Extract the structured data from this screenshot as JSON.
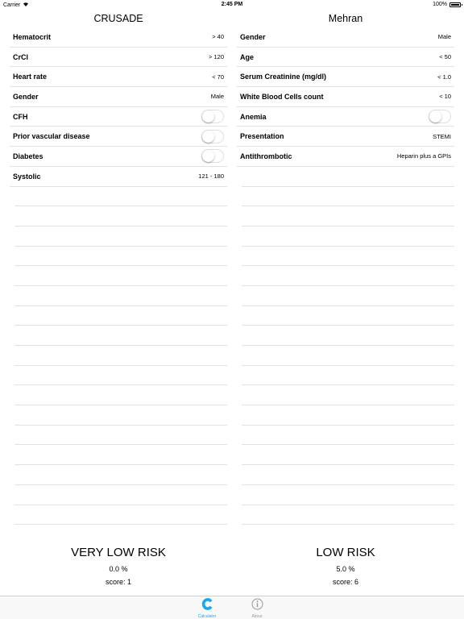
{
  "status_bar": {
    "carrier": "Carrier",
    "time": "2:45 PM",
    "battery": "100%"
  },
  "crusade": {
    "title": "CRUSADE",
    "rows": [
      {
        "label": "Hematocrit",
        "value": "> 40"
      },
      {
        "label": "CrCl",
        "value": "> 120"
      },
      {
        "label": "Heart rate",
        "value": "< 70"
      },
      {
        "label": "Gender",
        "value": "Male"
      },
      {
        "label": "CFH",
        "toggle": false
      },
      {
        "label": "Prior vascular disease",
        "toggle": false
      },
      {
        "label": "Diabetes",
        "toggle": false
      },
      {
        "label": "Systolic",
        "value": "121 - 180"
      }
    ],
    "result": {
      "risk_level": "VERY LOW RISK",
      "percent": "0.0 %",
      "score": "score: 1"
    }
  },
  "mehran": {
    "title": "Mehran",
    "rows": [
      {
        "label": "Gender",
        "value": "Male"
      },
      {
        "label": "Age",
        "value": "< 50"
      },
      {
        "label": "Serum Creatinine (mg/dl)",
        "value": "< 1.0"
      },
      {
        "label": "White Blood Cells count",
        "value": "< 10"
      },
      {
        "label": "Anemia",
        "toggle": false
      },
      {
        "label": "Presentation",
        "value": "STEMI"
      },
      {
        "label": "Antithrombotic",
        "value": "Heparin plus a GPIs"
      }
    ],
    "result": {
      "risk_level": "LOW RISK",
      "percent": "5.0 %",
      "score": "score: 6"
    }
  },
  "tab_bar": {
    "calculator_label": "Calculator",
    "about_label": "About",
    "calculator_icon": "calculator-c-icon",
    "about_icon": "info-icon",
    "active_color": "#18a9e8",
    "inactive_color": "#999999"
  }
}
